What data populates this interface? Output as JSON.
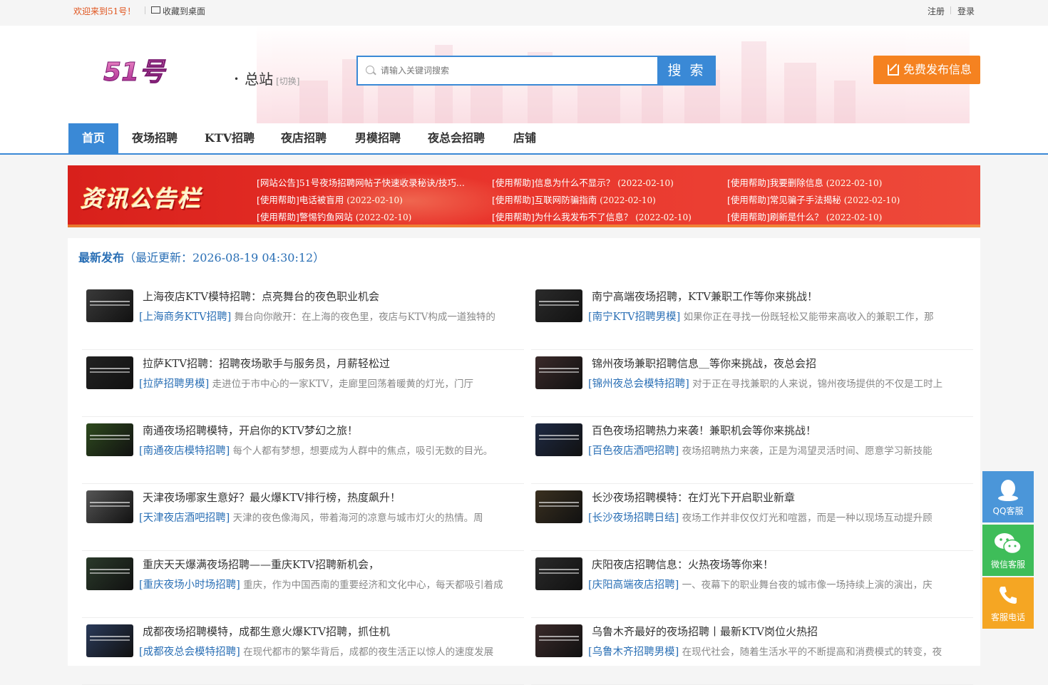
{
  "topbar": {
    "welcome": "欢迎来到51号！",
    "favorite": "收藏到桌面",
    "register": "注册",
    "login": "登录"
  },
  "header": {
    "logo_text": "51号",
    "city": "总站",
    "city_switch": "[切换]",
    "search_placeholder": "请输入关键词搜索",
    "search_button": "搜 索",
    "post_button": "免费发布信息"
  },
  "nav": [
    "首页",
    "夜场招聘",
    "KTV招聘",
    "夜店招聘",
    "男模招聘",
    "夜总会招聘",
    "店铺"
  ],
  "notice": {
    "title": "资讯公告栏",
    "items": [
      {
        "text": "[网站公告]51号夜场招聘网帖子快速收录秘诀/技巧...",
        "date": ""
      },
      {
        "text": "[使用帮助]信息为什么不显示？",
        "date": "(2022-02-10)"
      },
      {
        "text": "[使用帮助]我要删除信息",
        "date": "(2022-02-10)"
      },
      {
        "text": "[使用帮助]电话被盲用",
        "date": "(2022-02-10)"
      },
      {
        "text": "[使用帮助]互联网防骗指南",
        "date": "(2022-02-10)"
      },
      {
        "text": "[使用帮助]常见骗子手法揭秘",
        "date": "(2022-02-10)"
      },
      {
        "text": "[使用帮助]警惕钓鱼网站",
        "date": "(2022-02-10)"
      },
      {
        "text": "[使用帮助]为什么我发布不了信息？",
        "date": "(2022-02-10)"
      },
      {
        "text": "[使用帮助]刷新是什么？",
        "date": "(2022-02-10)"
      }
    ]
  },
  "latest": {
    "label": "最新发布",
    "update": "（最近更新：2026-08-19 04:30:12）",
    "cards": [
      {
        "title": "上海夜店KTV模特招聘：点亮舞台的夜色职业机会",
        "tag": "[上海商务KTV招聘]",
        "desc": " 舞台向你敞开：在上海的夜色里，夜店与KTV构成一道独特的",
        "thumb": "#3a3a3a"
      },
      {
        "title": "南宁高端夜场招聘，KTV兼职工作等你来挑战！",
        "tag": "[南宁KTV招聘男模]",
        "desc": " 如果你正在寻找一份既轻松又能带来高收入的兼职工作，那",
        "thumb": "#2b2b2b"
      },
      {
        "title": "拉萨KTV招聘：招聘夜场歌手与服务员，月薪轻松过",
        "tag": "[拉萨招聘男模]",
        "desc": " 走进位于市中心的一家KTV，走廊里回荡着暖黄的灯光，门厅",
        "thumb": "#222"
      },
      {
        "title": "锦州夜场兼职招聘信息＿等你来挑战，夜总会招",
        "tag": "[锦州夜总会模特招聘]",
        "desc": " 对于正在寻找兼职的人来说，锦州夜场提供的不仅是工时上",
        "thumb": "#3b2a2a"
      },
      {
        "title": "南通夜场招聘模特，开启你的KTV梦幻之旅！",
        "tag": "[南通夜店模特招聘]",
        "desc": " 每个人都有梦想，想要成为人群中的焦点，吸引无数的目光。",
        "thumb": "#2e4a1e"
      },
      {
        "title": "百色夜场招聘热力来袭！兼职机会等你来挑战！",
        "tag": "[百色夜店酒吧招聘]",
        "desc": " 夜场招聘热力来袭，正是为渴望灵活时间、愿意学习新技能",
        "thumb": "#1e2a44"
      },
      {
        "title": "天津夜场哪家生意好？最火爆KTV排行榜，热度飙升！",
        "tag": "[天津夜店酒吧招聘]",
        "desc": " 天津的夜色像海风，带着海河的凉意与城市灯火的热情。周",
        "thumb": "#555"
      },
      {
        "title": "长沙夜场招聘模特：在灯光下开启职业新章",
        "tag": "[长沙夜场招聘日结]",
        "desc": " 夜场工作并非仅仅灯光和喧嚣，而是一种以现场互动提升顾",
        "thumb": "#3a3020"
      },
      {
        "title": "重庆天天爆满夜场招聘——重庆KTV招聘新机会，",
        "tag": "[重庆夜场小时场招聘]",
        "desc": " 重庆，作为中国西南的重要经济和文化中心，每天都吸引着成",
        "thumb": "#2a3a2a"
      },
      {
        "title": "庆阳夜店招聘信息：火热夜场等你来！",
        "tag": "[庆阳高端夜店招聘]",
        "desc": " 一、夜幕下的职业舞台夜的城市像一场持续上演的演出，庆",
        "thumb": "#2a2a2a"
      },
      {
        "title": "成都夜场招聘模特，成都生意火爆KTV招聘，抓住机",
        "tag": "[成都夜总会模特招聘]",
        "desc": " 在现代都市的繁华背后，成都的夜生活正以惊人的速度发展",
        "thumb": "#2a3a5a"
      },
      {
        "title": "乌鲁木齐最好的夜场招聘丨最新KTV岗位火热招",
        "tag": "[乌鲁木齐招聘男模]",
        "desc": " 在现代社会，随着生活水平的不断提高和消费模式的转变，夜",
        "thumb": "#3a2a2a"
      }
    ]
  },
  "float": {
    "qq": "QQ客服",
    "wechat": "微信客服",
    "phone": "客服电话"
  },
  "colors": {
    "primary": "#3a89d6",
    "orange": "#f58220",
    "notice_red": "#e8322a",
    "qq": "#4b96d9",
    "wechat": "#3ebd59",
    "phone": "#f5a623"
  }
}
